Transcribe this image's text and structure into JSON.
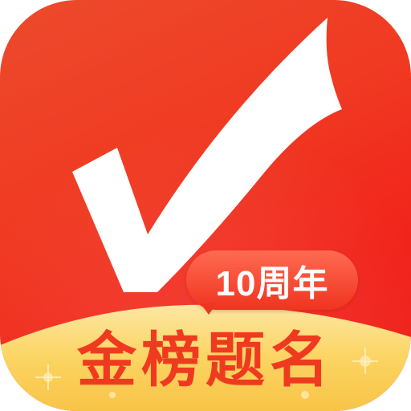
{
  "icon": {
    "name": "checkmark-icon",
    "badge_text": "10周年",
    "slogan": "金榜题名",
    "colors": {
      "background": "#f0281c",
      "gold": "#fbd364",
      "badge": "#f0341f",
      "text": "#f03a20"
    }
  }
}
